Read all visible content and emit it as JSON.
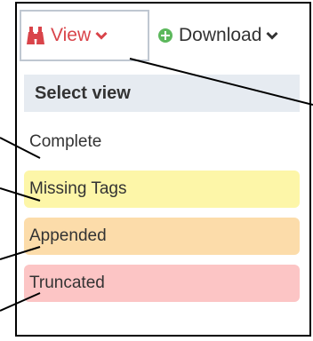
{
  "toolbar": {
    "view_label": "View",
    "download_label": "Download"
  },
  "menu": {
    "header": "Select view",
    "items": [
      {
        "label": "Complete",
        "color": "#ffffff"
      },
      {
        "label": "Missing Tags",
        "color": "#fdf6a8"
      },
      {
        "label": "Appended",
        "color": "#fcdcaa"
      },
      {
        "label": "Truncated",
        "color": "#fcc5c5"
      }
    ]
  },
  "colors": {
    "view_accent": "#d9444a",
    "download_icon": "#5cb85c",
    "header_bg": "#e6ebf1"
  },
  "icons": {
    "view": "binoculars-icon",
    "download": "plus-circle-icon",
    "caret": "chevron-down-icon"
  }
}
